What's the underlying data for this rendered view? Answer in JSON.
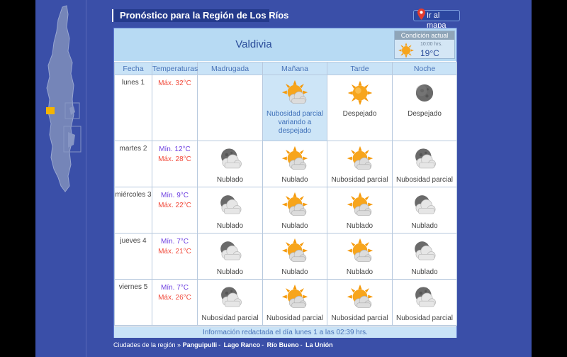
{
  "header": {
    "title": "Pronóstico para la Región de Los Ríos",
    "map_button": "Ir al mapa"
  },
  "city": "Valdivia",
  "current": {
    "title": "Condición actual",
    "time": "10:00 hrs.",
    "temp": "19°C",
    "icon": "sun-icon"
  },
  "columns": [
    "Fecha",
    "Temperaturas",
    "Madrugada",
    "Mañana",
    "Tarde",
    "Noche"
  ],
  "rows": [
    {
      "date": "lunes 1",
      "min": "",
      "max": "Máx. 32°C",
      "madrugada": {
        "label": "",
        "icon": ""
      },
      "manana": {
        "label": "Nubosidad parcial variando a despejado",
        "icon": "sun-cloud-icon"
      },
      "tarde": {
        "label": "Despejado",
        "icon": "sun-icon"
      },
      "noche": {
        "label": "Despejado",
        "icon": "moon-icon"
      }
    },
    {
      "date": "martes 2",
      "min": "Mín. 12°C",
      "max": "Máx. 28°C",
      "madrugada": {
        "label": "Nublado",
        "icon": "moon-cloud-icon"
      },
      "manana": {
        "label": "Nublado",
        "icon": "sun-cloud-icon"
      },
      "tarde": {
        "label": "Nubosidad parcial",
        "icon": "sun-cloud-icon"
      },
      "noche": {
        "label": "Nubosidad parcial",
        "icon": "moon-cloud-icon"
      }
    },
    {
      "date": "miércoles 3",
      "min": "Mín. 9°C",
      "max": "Máx. 22°C",
      "madrugada": {
        "label": "Nublado",
        "icon": "cloud-icon"
      },
      "manana": {
        "label": "Nublado",
        "icon": "sun-cloud-icon"
      },
      "tarde": {
        "label": "Nublado",
        "icon": "sun-cloud-icon"
      },
      "noche": {
        "label": "Nublado",
        "icon": "cloud-icon"
      }
    },
    {
      "date": "jueves 4",
      "min": "Mín. 7°C",
      "max": "Máx. 21°C",
      "madrugada": {
        "label": "Nublado",
        "icon": "cloud-icon"
      },
      "manana": {
        "label": "Nublado",
        "icon": "sun-cloud-icon"
      },
      "tarde": {
        "label": "Nublado",
        "icon": "sun-cloud-icon"
      },
      "noche": {
        "label": "Nublado",
        "icon": "cloud-icon"
      }
    },
    {
      "date": "viernes 5",
      "min": "Mín. 7°C",
      "max": "Máx. 26°C",
      "madrugada": {
        "label": "Nubosidad parcial",
        "icon": "moon-cloud-icon"
      },
      "manana": {
        "label": "Nubosidad parcial",
        "icon": "sun-cloud-icon"
      },
      "tarde": {
        "label": "Nubosidad parcial",
        "icon": "sun-cloud-icon"
      },
      "noche": {
        "label": "Nubosidad parcial",
        "icon": "moon-cloud-icon"
      }
    }
  ],
  "footer_note": "Información redactada el día lunes 1 a las 02:39 hrs.",
  "cities": {
    "prefix": "Ciudades de la región »",
    "items": [
      "Panguipulli",
      "Lago Ranco",
      "Río Bueno",
      "La Unión"
    ]
  },
  "colors": {
    "background": "#3a4fa8",
    "header_bg": "#b7daf3",
    "max_temp": "#f14a3b",
    "min_temp": "#6d3fe0",
    "highlight_region": "#f5b400"
  }
}
